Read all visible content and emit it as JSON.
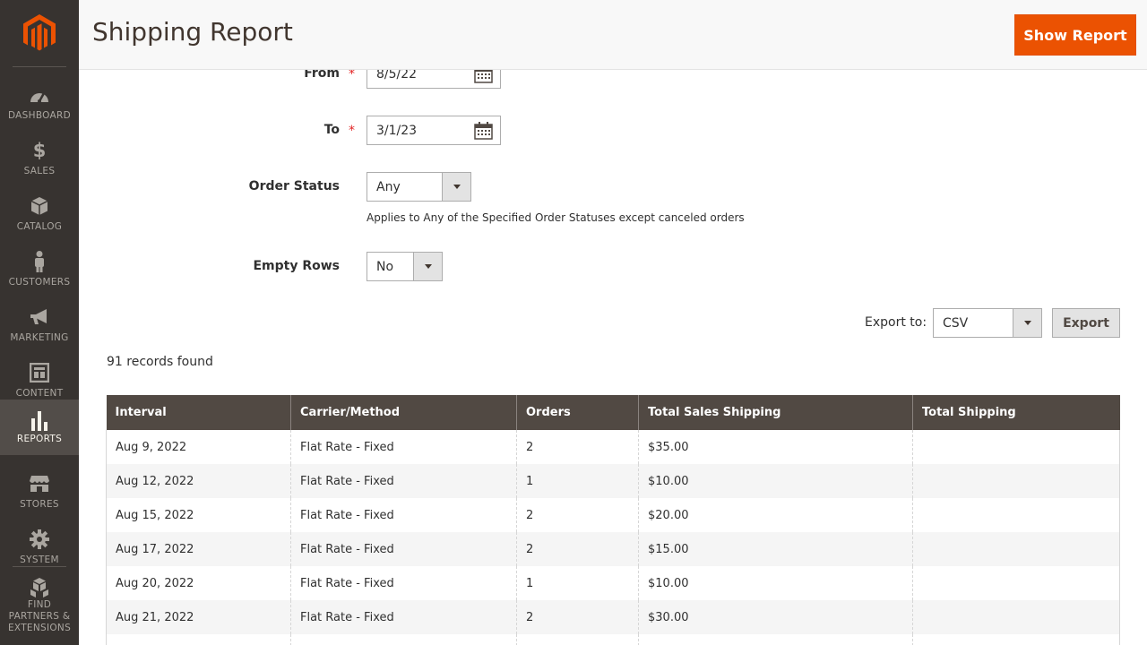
{
  "sidebar": {
    "items": [
      {
        "label": "DASHBOARD",
        "icon": "dashboard-icon"
      },
      {
        "label": "SALES",
        "icon": "dollar-icon"
      },
      {
        "label": "CATALOG",
        "icon": "box-icon"
      },
      {
        "label": "CUSTOMERS",
        "icon": "person-icon"
      },
      {
        "label": "MARKETING",
        "icon": "megaphone-icon"
      },
      {
        "label": "CONTENT",
        "icon": "layout-icon"
      },
      {
        "label": "REPORTS",
        "icon": "bar-chart-icon"
      },
      {
        "label": "STORES",
        "icon": "storefront-icon"
      },
      {
        "label": "SYSTEM",
        "icon": "gear-icon"
      },
      {
        "label_lines": [
          "FIND",
          "PARTNERS &",
          "EXTENSIONS"
        ],
        "icon": "boxes-icon"
      }
    ]
  },
  "header": {
    "title": "Shipping Report",
    "show_report": "Show Report"
  },
  "form": {
    "from_label": "From",
    "from_value": "8/5/22",
    "to_label": "To",
    "to_value": "3/1/23",
    "order_status_label": "Order Status",
    "order_status_value": "Any",
    "order_status_note": "Applies to Any of the Specified Order Statuses except canceled orders",
    "empty_rows_label": "Empty Rows",
    "empty_rows_value": "No",
    "required_mark": "*"
  },
  "export": {
    "label": "Export to:",
    "format": "CSV",
    "button": "Export"
  },
  "records_found": "91 records found",
  "table": {
    "columns": [
      "Interval",
      "Carrier/Method",
      "Orders",
      "Total Sales Shipping",
      "Total Shipping"
    ],
    "rows": [
      [
        "Aug 9, 2022",
        "Flat Rate - Fixed",
        "2",
        "$35.00",
        ""
      ],
      [
        "Aug 12, 2022",
        "Flat Rate - Fixed",
        "1",
        "$10.00",
        ""
      ],
      [
        "Aug 15, 2022",
        "Flat Rate - Fixed",
        "2",
        "$20.00",
        ""
      ],
      [
        "Aug 17, 2022",
        "Flat Rate - Fixed",
        "2",
        "$15.00",
        ""
      ],
      [
        "Aug 20, 2022",
        "Flat Rate - Fixed",
        "1",
        "$10.00",
        ""
      ],
      [
        "Aug 21, 2022",
        "Flat Rate - Fixed",
        "2",
        "$30.00",
        ""
      ],
      [
        "",
        "",
        "",
        "",
        ""
      ]
    ]
  },
  "colors": {
    "sidebar": "#373330",
    "accent": "#eb5202",
    "table_header": "#514943"
  }
}
